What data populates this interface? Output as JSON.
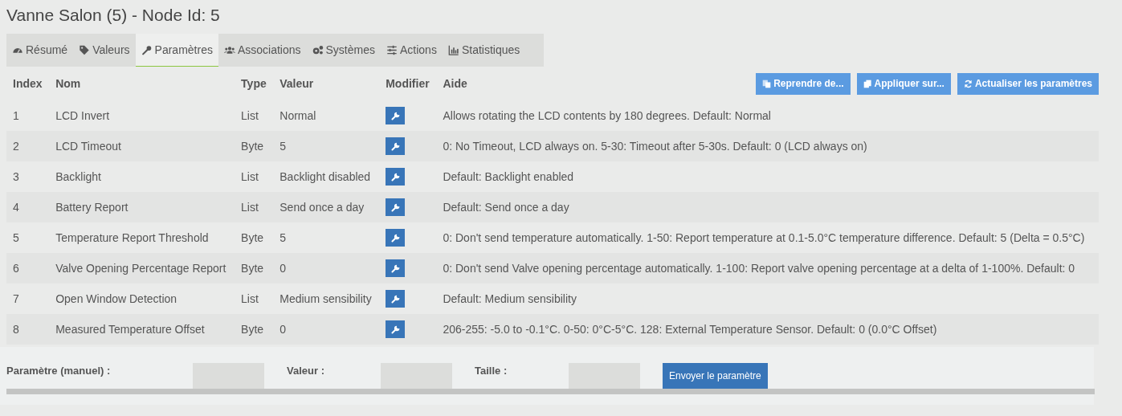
{
  "title": "Vanne Salon (5) - Node Id: 5",
  "tabs": [
    {
      "label": "Résumé",
      "selected": false
    },
    {
      "label": "Valeurs",
      "selected": false
    },
    {
      "label": "Paramètres",
      "selected": true
    },
    {
      "label": "Associations",
      "selected": false
    },
    {
      "label": "Systèmes",
      "selected": false
    },
    {
      "label": "Actions",
      "selected": false
    },
    {
      "label": "Statistiques",
      "selected": false
    }
  ],
  "table": {
    "columns": [
      "Index",
      "Nom",
      "Type",
      "Valeur",
      "Modifier",
      "Aide"
    ],
    "header_buttons": [
      "Reprendre de...",
      "Appliquer sur...",
      "Actualiser les paramètres"
    ],
    "rows": [
      {
        "index": "1",
        "name": "LCD Invert",
        "type": "List",
        "value": "Normal",
        "help": "Allows rotating the LCD contents by 180 degrees. Default: Normal"
      },
      {
        "index": "2",
        "name": "LCD Timeout",
        "type": "Byte",
        "value": "5",
        "help": "0: No Timeout, LCD always on. 5-30: Timeout after 5-30s. Default: 0 (LCD always on)"
      },
      {
        "index": "3",
        "name": "Backlight",
        "type": "List",
        "value": "Backlight disabled",
        "help": "Default: Backlight enabled"
      },
      {
        "index": "4",
        "name": "Battery Report",
        "type": "List",
        "value": "Send once a day",
        "help": "Default: Send once a day"
      },
      {
        "index": "5",
        "name": "Temperature Report Threshold",
        "type": "Byte",
        "value": "5",
        "help": "0: Don't send temperature automatically. 1-50: Report temperature at 0.1-5.0°C temperature difference. Default: 5 (Delta = 0.5°C)"
      },
      {
        "index": "6",
        "name": "Valve Opening Percentage Report",
        "type": "Byte",
        "value": "0",
        "help": "0: Don't send Valve opening percentage automatically. 1-100: Report valve opening percentage at a delta of 1-100%. Default: 0"
      },
      {
        "index": "7",
        "name": "Open Window Detection",
        "type": "List",
        "value": "Medium sensibility",
        "help": "Default: Medium sensibility"
      },
      {
        "index": "8",
        "name": "Measured Temperature Offset",
        "type": "Byte",
        "value": "0",
        "help": "206-255: -5.0 to -0.1°C. 0-50: 0°C-5°C. 128: External Temperature Sensor. Default: 0 (0.0°C Offset)"
      }
    ]
  },
  "manual": {
    "fields": [
      {
        "label": "Paramètre (manuel) :"
      },
      {
        "label": "Valeur :"
      },
      {
        "label": "Taille :"
      }
    ],
    "button": "Envoyer le paramètre"
  }
}
